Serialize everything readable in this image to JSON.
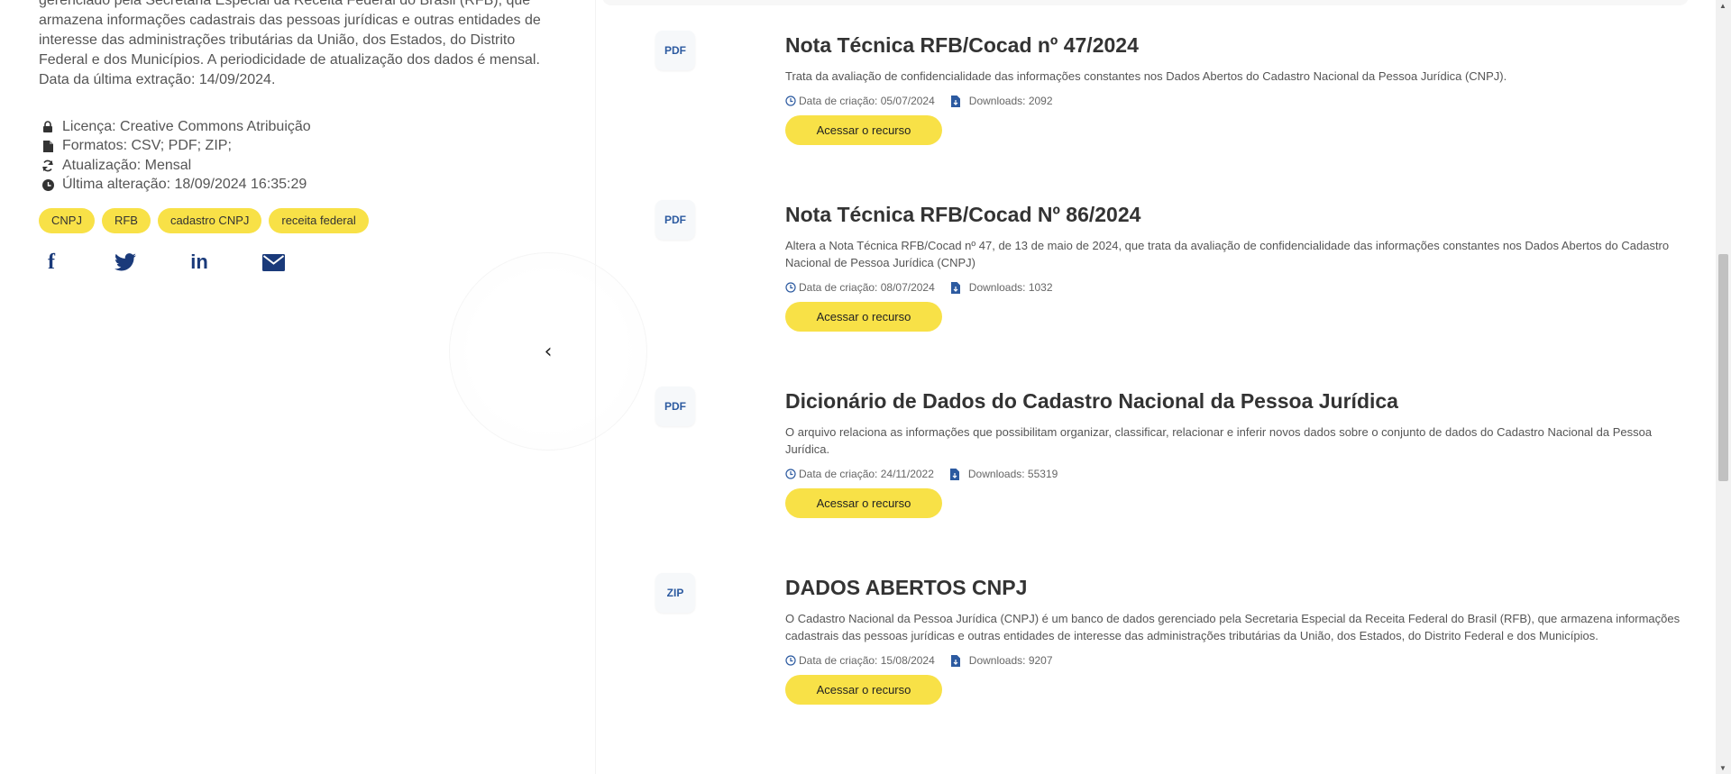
{
  "dataset": {
    "description": "gerenciado pela Secretaria Especial da Receita Federal do Brasil (RFB), que armazena informações cadastrais das pessoas jurídicas e outras entidades de interesse das administrações tributárias da União, dos Estados, do Distrito Federal e dos Municípios. A periodicidade de atualização dos dados é mensal. Data da última extração: 14/09/2024.",
    "license": "Licença: Creative Commons Atribuição",
    "formats": "Formatos: CSV; PDF; ZIP;",
    "update": "Atualização: Mensal",
    "last_change": "Última alteração: 18/09/2024 16:35:29",
    "tags": [
      "CNPJ",
      "RFB",
      "cadastro CNPJ",
      "receita federal"
    ]
  },
  "share": {
    "facebook": "f",
    "linkedin": "in"
  },
  "collapse_glyph": "‹",
  "resources": [
    {
      "format": "PDF",
      "title": "Nota Técnica RFB/Cocad nº 47/2024",
      "description": "Trata da avaliação de confidencialidade das informações constantes nos Dados Abertos do Cadastro Nacional da Pessoa Jurídica (CNPJ).",
      "created": "Data de criação: 05/07/2024",
      "downloads": "Downloads: 2092",
      "button": "Acessar o recurso"
    },
    {
      "format": "PDF",
      "title": "Nota Técnica RFB/Cocad Nº 86/2024",
      "description": "Altera a Nota Técnica RFB/Cocad nº 47, de 13 de maio de 2024, que trata da avaliação de confidencialidade das informações constantes nos Dados Abertos do Cadastro Nacional de Pessoa Jurídica (CNPJ)",
      "created": "Data de criação: 08/07/2024",
      "downloads": "Downloads: 1032",
      "button": "Acessar o recurso"
    },
    {
      "format": "PDF",
      "title": "Dicionário de Dados do Cadastro Nacional da Pessoa Jurídica",
      "description": "O arquivo relaciona as informações que possibilitam organizar, classificar, relacionar e inferir novos dados sobre o conjunto de dados do Cadastro Nacional da Pessoa Jurídica.",
      "created": "Data de criação: 24/11/2022",
      "downloads": "Downloads: 55319",
      "button": "Acessar o recurso"
    },
    {
      "format": "ZIP",
      "title": "DADOS ABERTOS CNPJ",
      "description": "O Cadastro Nacional da Pessoa Jurídica (CNPJ) é um banco de dados gerenciado pela Secretaria Especial da Receita Federal do Brasil (RFB), que armazena informações cadastrais das pessoas jurídicas e outras entidades de interesse das administrações tributárias da União, dos Estados, do Distrito Federal e dos Municípios.",
      "created": "Data de criação: 15/08/2024",
      "downloads": "Downloads: 9207",
      "button": "Acessar o recurso"
    }
  ],
  "colors": {
    "accent_yellow": "#f8e147",
    "badge_text": "#2c5aa0",
    "share_icons": "#1a3a7a"
  },
  "icons": {
    "license": "lock-icon",
    "formats": "file-icon",
    "update": "refresh-icon",
    "last_change": "clock-icon",
    "created": "clock-icon",
    "downloads": "file-download-icon"
  }
}
